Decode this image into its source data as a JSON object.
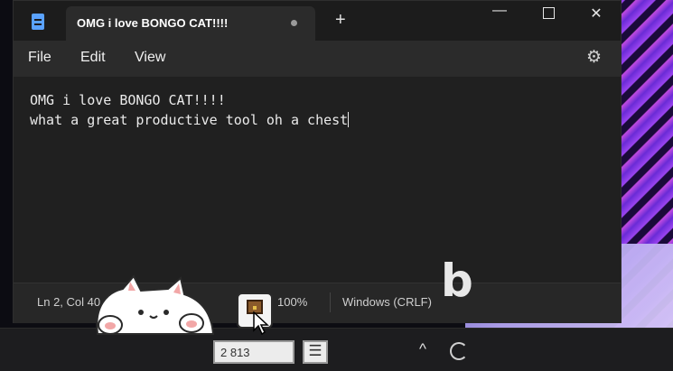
{
  "window": {
    "tab_title": "OMG i love BONGO CAT!!!!",
    "new_tab_symbol": "+",
    "minimize_symbol": "—",
    "close_symbol": "✕"
  },
  "menu": {
    "file": "File",
    "edit": "Edit",
    "view": "View",
    "settings_icon": "gear-icon"
  },
  "editor": {
    "lines": [
      "OMG i love BONGO CAT!!!!",
      "what a great productive tool oh a chest"
    ]
  },
  "status": {
    "position": "Ln 2, Col 40",
    "zoom": "100%",
    "line_ending": "Windows (CRLF)"
  },
  "overlay": {
    "bing_letter": "b"
  },
  "taskbar": {
    "counter": "2 813",
    "menu_symbol": "☰",
    "chevron": "^"
  },
  "colors": {
    "window_bg": "#202020",
    "accent": "#5aa2ff",
    "wallpaper": "#9b44f0"
  }
}
